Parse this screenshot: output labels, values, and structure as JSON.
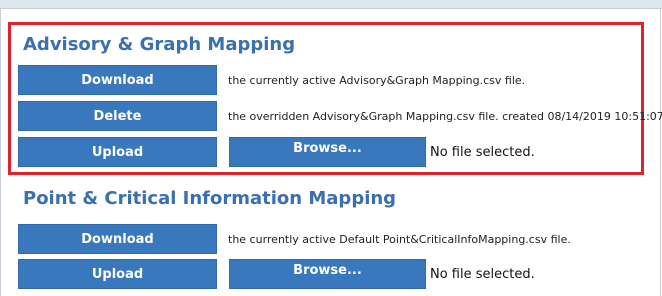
{
  "sections": [
    {
      "title": "Advisory & Graph Mapping",
      "rows": [
        {
          "button": "Download",
          "text": "the currently active Advisory&Graph Mapping.csv file."
        },
        {
          "button": "Delete",
          "text": "the overridden Advisory&Graph Mapping.csv file. created 08/14/2019 10:51:07"
        },
        {
          "button": "Upload",
          "browse": "Browse...",
          "status": "No file selected."
        }
      ]
    },
    {
      "title": "Point & Critical Information Mapping",
      "rows": [
        {
          "button": "Download",
          "text": "the currently active Default Point&CriticalInfoMapping.csv file."
        },
        {
          "button": "Upload",
          "browse": "Browse...",
          "status": "No file selected."
        }
      ]
    }
  ],
  "colors": {
    "button": "#3a78bd",
    "title": "#3a6fb0",
    "highlight": "#e0232b"
  }
}
